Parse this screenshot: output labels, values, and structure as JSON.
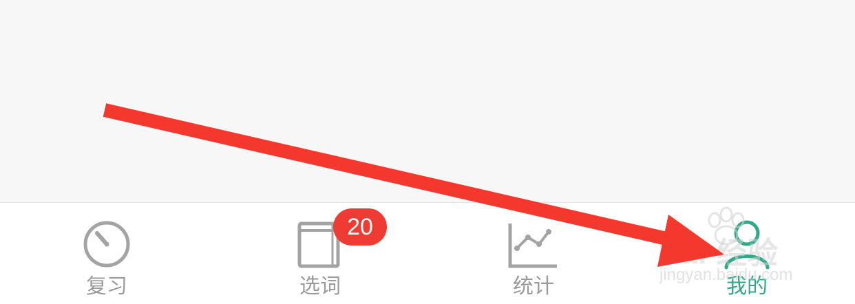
{
  "tabbar": {
    "tabs": [
      {
        "label": "复习",
        "icon": "speedometer-icon",
        "active": false
      },
      {
        "label": "选词",
        "icon": "book-icon",
        "active": false,
        "badge": "20"
      },
      {
        "label": "统计",
        "icon": "line-chart-icon",
        "active": false
      },
      {
        "label": "我的",
        "icon": "person-icon",
        "active": true
      }
    ]
  },
  "watermark": {
    "brand": "Bai 经验",
    "url": "jingyan.baidu.com"
  },
  "colors": {
    "background": "#f7f7f7",
    "tabbar_background": "#ffffff",
    "inactive": "#9a9a9a",
    "active": "#2fa98a",
    "badge": "#ee3b33",
    "annotation_arrow": "#f4382e"
  }
}
